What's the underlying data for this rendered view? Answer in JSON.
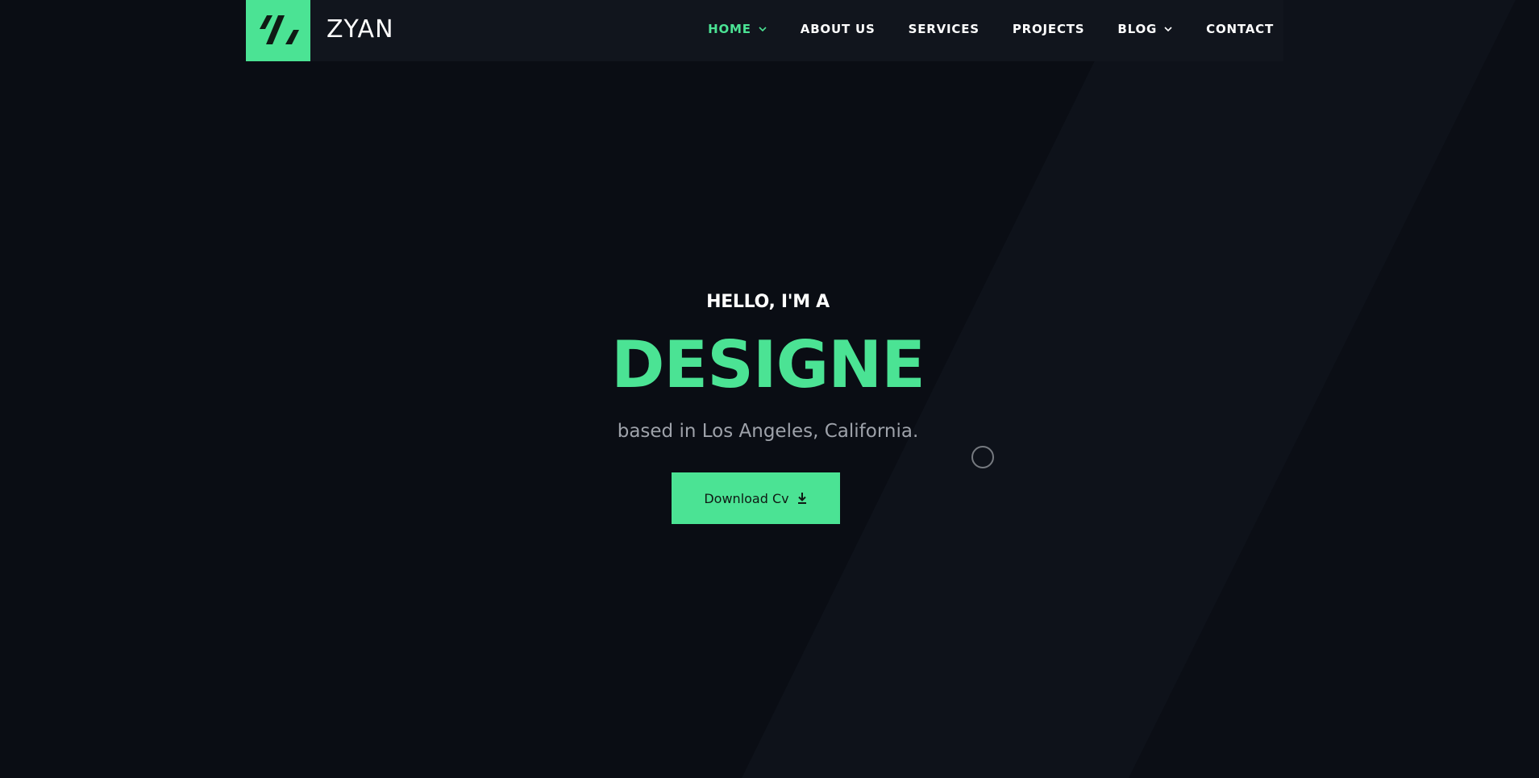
{
  "brand": {
    "logo_icon": "three-slashes-logo-icon",
    "name": "ZYAN",
    "accent_color": "#4be394"
  },
  "nav": {
    "items": [
      {
        "label": "HOME",
        "active": true,
        "dropdown": true
      },
      {
        "label": "ABOUT US",
        "active": false,
        "dropdown": false
      },
      {
        "label": "SERVICES",
        "active": false,
        "dropdown": false
      },
      {
        "label": "PROJECTS",
        "active": false,
        "dropdown": false
      },
      {
        "label": "BLOG",
        "active": false,
        "dropdown": true
      },
      {
        "label": "CONTACT",
        "active": false,
        "dropdown": false
      }
    ]
  },
  "hero": {
    "greeting": "HELLO, I'M A",
    "role": "DESIGNE",
    "location": "based in Los Angeles, California.",
    "cta_label": "Download Cv",
    "cta_icon": "download-icon"
  },
  "colors": {
    "background": "#0a0d14",
    "header": "#11151d",
    "accent": "#4be394",
    "muted_text": "#9ea2aa"
  }
}
